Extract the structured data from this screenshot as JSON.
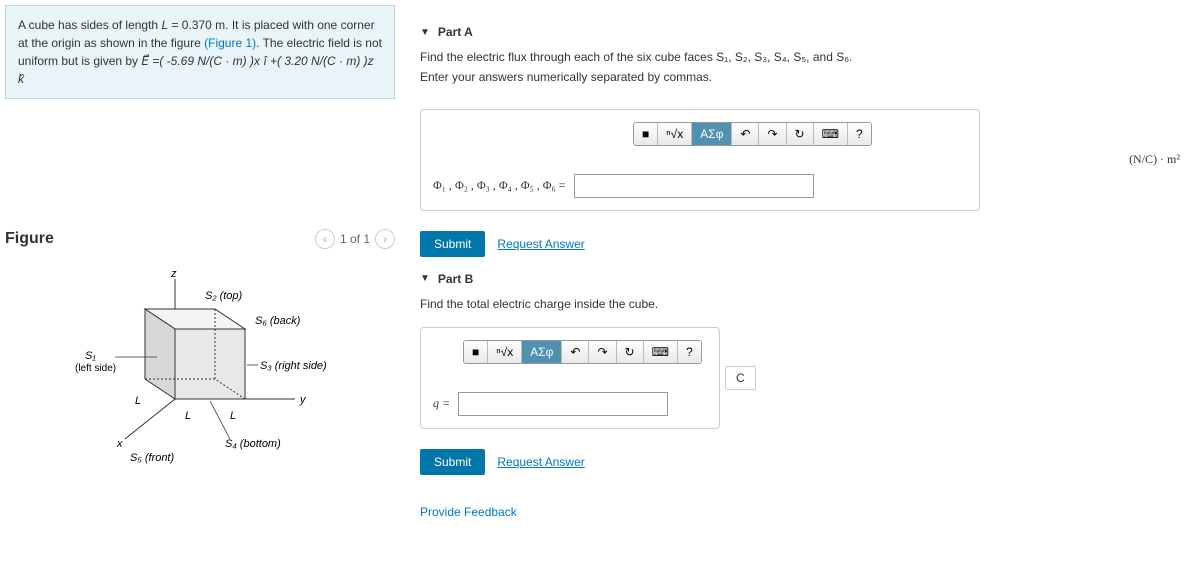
{
  "problem": {
    "text_prefix": "A cube has sides of length ",
    "length_var": "L",
    "length_val": "= 0.370 m",
    "text_mid1": ". It is placed with one corner at the origin as shown in the figure ",
    "figure_ref": "(Figure 1)",
    "text_mid2": ". The electric field is not uniform but is given by ",
    "field_eq": "E⃗ =( -5.69 N/(C · m) )x î +( 3.20 N/(C · m) )z k̂"
  },
  "figure": {
    "title": "Figure",
    "nav_text": "1 of 1",
    "labels": {
      "s1": "S₁",
      "s1_desc": "(left side)",
      "s2": "S₂ (top)",
      "s3": "S₃ (right side)",
      "s4": "S₄ (bottom)",
      "s5": "S₅ (front)",
      "s6": "S₆ (back)",
      "L": "L",
      "x": "x",
      "y": "y",
      "z": "z"
    }
  },
  "partA": {
    "title": "Part A",
    "question": "Find the electric flux through each of the six cube faces S₁, S₂, S₃, S₄, S₅, and S₆.",
    "instruction": "Enter your answers numerically separated by commas.",
    "label": "Φ₁ , Φ₂ , Φ₃ , Φ₄ , Φ₅ , Φ₆ =",
    "unit": "(N/C) · m²",
    "submit": "Submit",
    "request": "Request Answer"
  },
  "partB": {
    "title": "Part B",
    "question": "Find the total electric charge inside the cube.",
    "label": "q =",
    "unit": "C",
    "submit": "Submit",
    "request": "Request Answer"
  },
  "toolbar": {
    "template": "■",
    "sqrt": "ⁿ√x",
    "greek": "ΑΣφ",
    "undo": "↶",
    "redo": "↷",
    "reset": "↻",
    "keyboard": "⌨",
    "help": "?"
  },
  "feedback": "Provide Feedback"
}
